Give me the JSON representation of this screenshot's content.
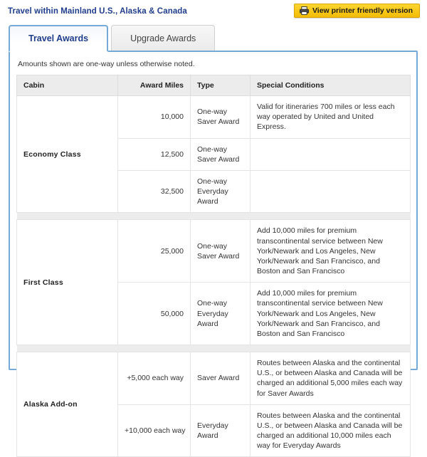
{
  "header": {
    "title": "Travel within Mainland U.S., Alaska & Canada",
    "printer_button_label": "View printer friendly version",
    "printer_icon": "printer-icon",
    "accent_color": "#1f3d8c",
    "button_color": "#f2bc02"
  },
  "tabs": [
    {
      "label": "Travel Awards",
      "active": true
    },
    {
      "label": "Upgrade Awards",
      "active": false
    }
  ],
  "panel": {
    "note": "Amounts shown are one-way unless otherwise noted.",
    "border_color": "#74a9d8"
  },
  "table": {
    "columns": [
      "Cabin",
      "Award Miles",
      "Type",
      "Special Conditions"
    ],
    "sections": [
      {
        "cabin": "Economy Class",
        "rows": [
          {
            "miles": "10,000",
            "type": "One-way Saver Award",
            "conditions": "Valid for itineraries 700 miles or less each way operated by United and United Express."
          },
          {
            "miles": "12,500",
            "type": "One-way Saver Award",
            "conditions": ""
          },
          {
            "miles": "32,500",
            "type": "One-way Everyday Award",
            "conditions": ""
          }
        ]
      },
      {
        "cabin": "First Class",
        "rows": [
          {
            "miles": "25,000",
            "type": "One-way Saver Award",
            "conditions": "Add 10,000 miles for premium transcontinental service between New York/Newark and Los Angeles, New York/Newark and San Francisco, and Boston and San Francisco"
          },
          {
            "miles": "50,000",
            "type": "One-way Everyday Award",
            "conditions": "Add 10,000 miles for premium transcontinental service between New York/Newark and Los Angeles, New York/Newark and San Francisco, and Boston and San Francisco"
          }
        ]
      },
      {
        "cabin": "Alaska Add-on",
        "rows": [
          {
            "miles": "+5,000 each way",
            "type": "Saver Award",
            "conditions": "Routes between Alaska and the continental U.S., or between Alaska and Canada will be charged an additional 5,000 miles each way for Saver Awards"
          },
          {
            "miles": "+10,000 each way",
            "type": "Everyday Award",
            "conditions": "Routes between Alaska and the continental U.S., or between Alaska and Canada will be charged an additional 10,000 miles each way for Everyday Awards"
          }
        ]
      }
    ]
  }
}
